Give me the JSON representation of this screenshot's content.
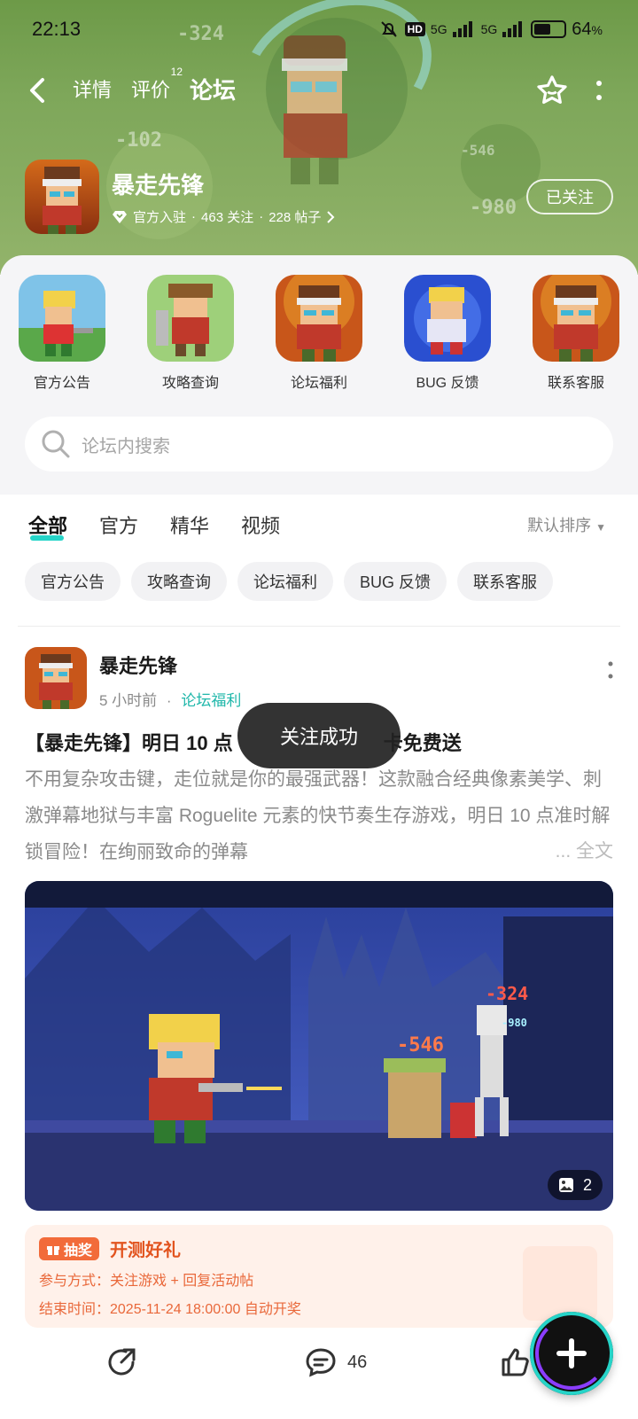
{
  "status_bar": {
    "time": "22:13",
    "hd": "HD",
    "net1": "5G",
    "net2": "5G",
    "battery": "64",
    "battery_unit": "%"
  },
  "nav": {
    "tabs": [
      {
        "label": "详情"
      },
      {
        "label": "评价",
        "badge": "12"
      },
      {
        "label": "论坛"
      }
    ],
    "active_tab": "论坛"
  },
  "game": {
    "name": "暴走先锋",
    "meta_official": "官方入驻",
    "meta_follow": "463 关注",
    "meta_posts": "228 帖子",
    "follow_button": "已关注"
  },
  "hero_damage_numbers": [
    "-324",
    "-102",
    "-546",
    "-980"
  ],
  "forums": [
    {
      "label": "官方公告"
    },
    {
      "label": "攻略查询"
    },
    {
      "label": "论坛福利"
    },
    {
      "label": "BUG 反馈"
    },
    {
      "label": "联系客服"
    }
  ],
  "search": {
    "placeholder": "论坛内搜索"
  },
  "filter_tabs": [
    "全部",
    "官方",
    "精华",
    "视频"
  ],
  "sort": "默认排序",
  "chips": [
    "官方公告",
    "攻略查询",
    "论坛福利",
    "BUG 反馈",
    "联系客服"
  ],
  "post": {
    "author": "暴走先锋",
    "time": "5 小时前",
    "separator": "·",
    "tag": "论坛福利",
    "title": "【暴走先锋】明日 10 点",
    "title_tail": "卡免费送",
    "body": "不用复杂攻击键，走位就是你的最强武器！这款融合经典像素美学、刺激弹幕地狱与丰富 Roguelite 元素的快节奏生存游戏，明日 10 点准时解锁冒险！在绚丽致命的弹幕",
    "more_label": "... 全文",
    "image_count": "2",
    "image_damage": [
      "-324",
      "-546",
      "-980"
    ]
  },
  "lottery": {
    "badge": "抽奖",
    "title": "开测好礼",
    "line1": "参与方式：关注游戏 + 回复活动帖",
    "line2": "结束时间：2025-11-24 18:00:00 自动开奖"
  },
  "actions": {
    "comments": "46"
  },
  "toast": "关注成功",
  "colors": {
    "accent": "#26d4c8",
    "tag": "#1fb7aa",
    "lottery": "#f26b3a",
    "hero_green": "#7ea75a"
  }
}
